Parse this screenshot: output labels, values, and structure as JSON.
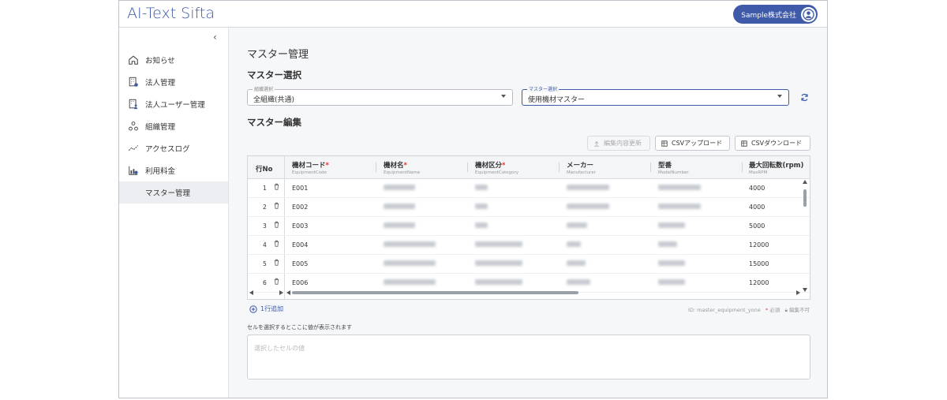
{
  "app": {
    "logo_text": "AI-Text Sifta",
    "user_label": "Sample株式会社",
    "accent": "#3e5aa8"
  },
  "sidebar": {
    "collapse_glyph": "‹",
    "items": [
      {
        "label": "お知らせ",
        "icon": "home-icon"
      },
      {
        "label": "法人管理",
        "icon": "corporation-icon"
      },
      {
        "label": "法人ユーザー管理",
        "icon": "corporate-user-icon"
      },
      {
        "label": "組織管理",
        "icon": "organization-icon"
      },
      {
        "label": "アクセスログ",
        "icon": "access-log-icon"
      },
      {
        "label": "利用料金",
        "icon": "billing-icon"
      },
      {
        "label": "マスター管理",
        "icon": ""
      }
    ]
  },
  "page": {
    "title": "マスター管理",
    "section_select": "マスター選択",
    "org_select": {
      "label": "組織選択",
      "value": "全組織(共通)"
    },
    "master_select": {
      "label": "マスター選択",
      "value": "使用機材マスター"
    },
    "section_edit": "マスター編集",
    "buttons": {
      "update": "編集内容更新",
      "upload": "CSVアップロード",
      "download": "CSVダウンロード"
    },
    "table": {
      "columns": [
        {
          "label": "行No",
          "sub": ""
        },
        {
          "label": "機材コード",
          "sub": "EquipmentCode",
          "required": "*"
        },
        {
          "label": "機材名",
          "sub": "EquipmentName",
          "required": "*"
        },
        {
          "label": "機材区分",
          "sub": "EquipmentCategory",
          "required": "*"
        },
        {
          "label": "メーカー",
          "sub": "Manufacturer"
        },
        {
          "label": "型番",
          "sub": "ModelNumber"
        },
        {
          "label": "最大回転数(rpm)",
          "sub": "MaxRPM"
        }
      ],
      "rows": [
        {
          "no": "1",
          "code": "E001",
          "rpm": "4000"
        },
        {
          "no": "2",
          "code": "E002",
          "rpm": "4000"
        },
        {
          "no": "3",
          "code": "E003",
          "rpm": "5000"
        },
        {
          "no": "4",
          "code": "E004",
          "rpm": "12000"
        },
        {
          "no": "5",
          "code": "E005",
          "rpm": "15000"
        },
        {
          "no": "6",
          "code": "E006",
          "rpm": "12000"
        }
      ]
    },
    "add_row": "1行追加",
    "meta": {
      "id": "ID: master_equipment_yone",
      "required": "必須",
      "readonly": "編集不可"
    },
    "cell_hint": "セルを選択するとここに値が表示されます",
    "cell_placeholder": "選択したセルの値"
  }
}
